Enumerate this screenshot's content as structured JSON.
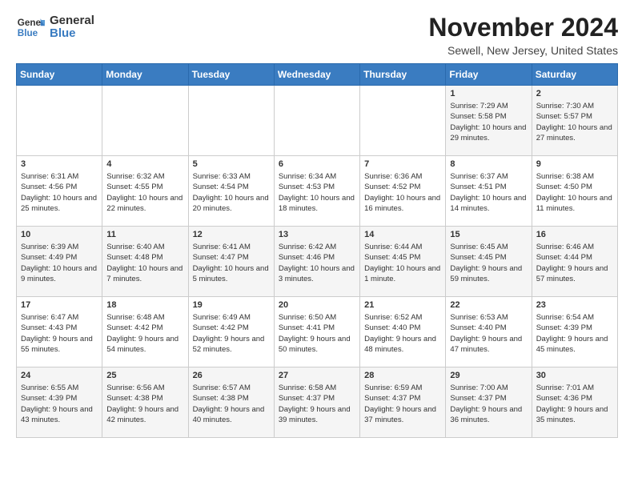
{
  "logo": {
    "general": "General",
    "blue": "Blue"
  },
  "title": "November 2024",
  "location": "Sewell, New Jersey, United States",
  "days_of_week": [
    "Sunday",
    "Monday",
    "Tuesday",
    "Wednesday",
    "Thursday",
    "Friday",
    "Saturday"
  ],
  "weeks": [
    [
      {
        "day": "",
        "info": ""
      },
      {
        "day": "",
        "info": ""
      },
      {
        "day": "",
        "info": ""
      },
      {
        "day": "",
        "info": ""
      },
      {
        "day": "",
        "info": ""
      },
      {
        "day": "1",
        "info": "Sunrise: 7:29 AM\nSunset: 5:58 PM\nDaylight: 10 hours and 29 minutes."
      },
      {
        "day": "2",
        "info": "Sunrise: 7:30 AM\nSunset: 5:57 PM\nDaylight: 10 hours and 27 minutes."
      }
    ],
    [
      {
        "day": "3",
        "info": "Sunrise: 6:31 AM\nSunset: 4:56 PM\nDaylight: 10 hours and 25 minutes."
      },
      {
        "day": "4",
        "info": "Sunrise: 6:32 AM\nSunset: 4:55 PM\nDaylight: 10 hours and 22 minutes."
      },
      {
        "day": "5",
        "info": "Sunrise: 6:33 AM\nSunset: 4:54 PM\nDaylight: 10 hours and 20 minutes."
      },
      {
        "day": "6",
        "info": "Sunrise: 6:34 AM\nSunset: 4:53 PM\nDaylight: 10 hours and 18 minutes."
      },
      {
        "day": "7",
        "info": "Sunrise: 6:36 AM\nSunset: 4:52 PM\nDaylight: 10 hours and 16 minutes."
      },
      {
        "day": "8",
        "info": "Sunrise: 6:37 AM\nSunset: 4:51 PM\nDaylight: 10 hours and 14 minutes."
      },
      {
        "day": "9",
        "info": "Sunrise: 6:38 AM\nSunset: 4:50 PM\nDaylight: 10 hours and 11 minutes."
      }
    ],
    [
      {
        "day": "10",
        "info": "Sunrise: 6:39 AM\nSunset: 4:49 PM\nDaylight: 10 hours and 9 minutes."
      },
      {
        "day": "11",
        "info": "Sunrise: 6:40 AM\nSunset: 4:48 PM\nDaylight: 10 hours and 7 minutes."
      },
      {
        "day": "12",
        "info": "Sunrise: 6:41 AM\nSunset: 4:47 PM\nDaylight: 10 hours and 5 minutes."
      },
      {
        "day": "13",
        "info": "Sunrise: 6:42 AM\nSunset: 4:46 PM\nDaylight: 10 hours and 3 minutes."
      },
      {
        "day": "14",
        "info": "Sunrise: 6:44 AM\nSunset: 4:45 PM\nDaylight: 10 hours and 1 minute."
      },
      {
        "day": "15",
        "info": "Sunrise: 6:45 AM\nSunset: 4:45 PM\nDaylight: 9 hours and 59 minutes."
      },
      {
        "day": "16",
        "info": "Sunrise: 6:46 AM\nSunset: 4:44 PM\nDaylight: 9 hours and 57 minutes."
      }
    ],
    [
      {
        "day": "17",
        "info": "Sunrise: 6:47 AM\nSunset: 4:43 PM\nDaylight: 9 hours and 55 minutes."
      },
      {
        "day": "18",
        "info": "Sunrise: 6:48 AM\nSunset: 4:42 PM\nDaylight: 9 hours and 54 minutes."
      },
      {
        "day": "19",
        "info": "Sunrise: 6:49 AM\nSunset: 4:42 PM\nDaylight: 9 hours and 52 minutes."
      },
      {
        "day": "20",
        "info": "Sunrise: 6:50 AM\nSunset: 4:41 PM\nDaylight: 9 hours and 50 minutes."
      },
      {
        "day": "21",
        "info": "Sunrise: 6:52 AM\nSunset: 4:40 PM\nDaylight: 9 hours and 48 minutes."
      },
      {
        "day": "22",
        "info": "Sunrise: 6:53 AM\nSunset: 4:40 PM\nDaylight: 9 hours and 47 minutes."
      },
      {
        "day": "23",
        "info": "Sunrise: 6:54 AM\nSunset: 4:39 PM\nDaylight: 9 hours and 45 minutes."
      }
    ],
    [
      {
        "day": "24",
        "info": "Sunrise: 6:55 AM\nSunset: 4:39 PM\nDaylight: 9 hours and 43 minutes."
      },
      {
        "day": "25",
        "info": "Sunrise: 6:56 AM\nSunset: 4:38 PM\nDaylight: 9 hours and 42 minutes."
      },
      {
        "day": "26",
        "info": "Sunrise: 6:57 AM\nSunset: 4:38 PM\nDaylight: 9 hours and 40 minutes."
      },
      {
        "day": "27",
        "info": "Sunrise: 6:58 AM\nSunset: 4:37 PM\nDaylight: 9 hours and 39 minutes."
      },
      {
        "day": "28",
        "info": "Sunrise: 6:59 AM\nSunset: 4:37 PM\nDaylight: 9 hours and 37 minutes."
      },
      {
        "day": "29",
        "info": "Sunrise: 7:00 AM\nSunset: 4:37 PM\nDaylight: 9 hours and 36 minutes."
      },
      {
        "day": "30",
        "info": "Sunrise: 7:01 AM\nSunset: 4:36 PM\nDaylight: 9 hours and 35 minutes."
      }
    ]
  ]
}
